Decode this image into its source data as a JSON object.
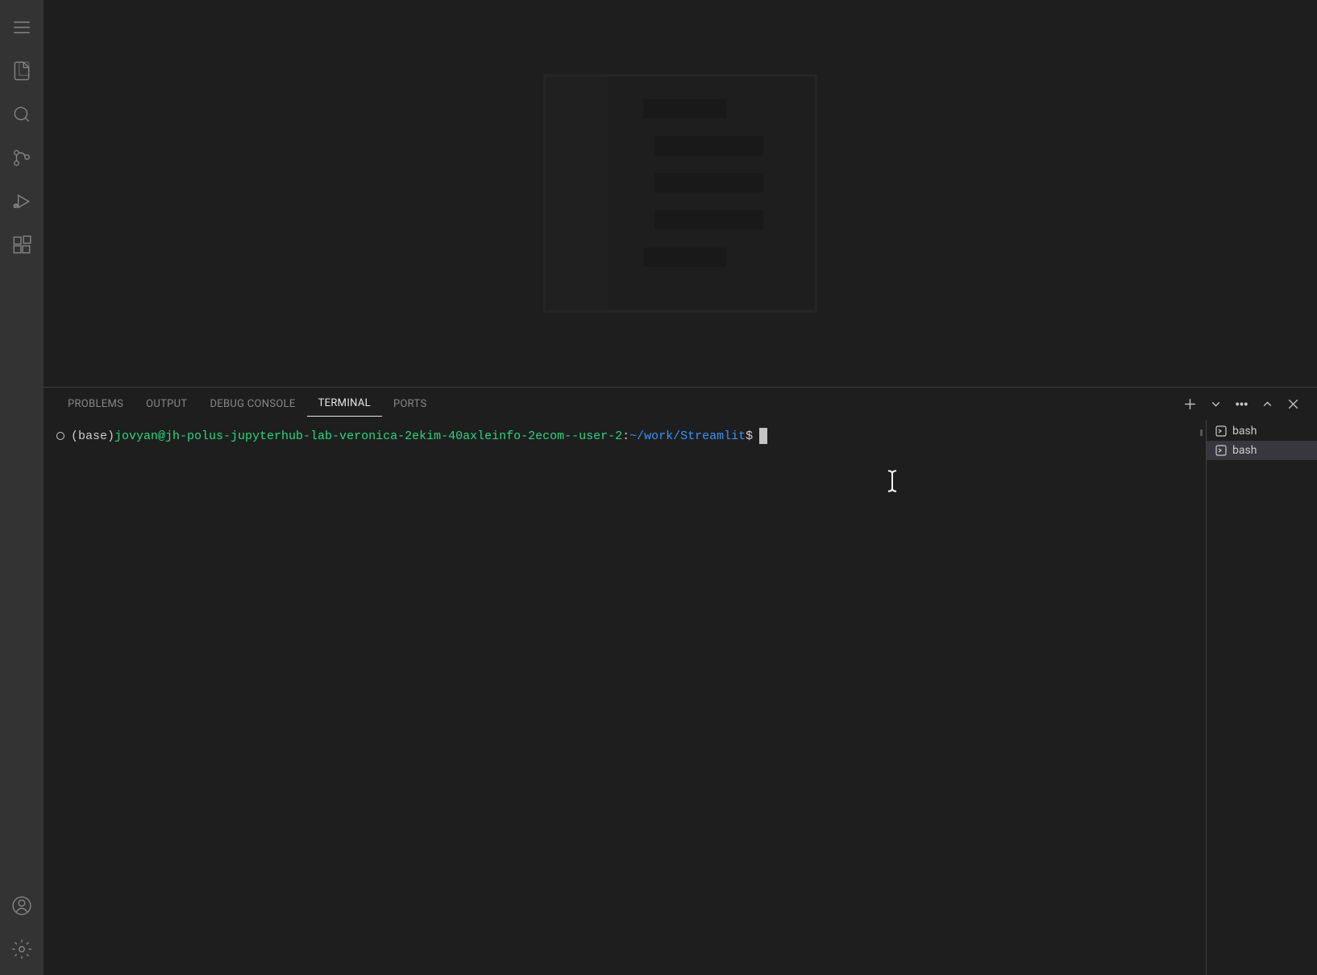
{
  "panel": {
    "tabs": {
      "problems": "PROBLEMS",
      "output": "OUTPUT",
      "debugConsole": "DEBUG CONSOLE",
      "terminal": "TERMINAL",
      "ports": "PORTS"
    }
  },
  "terminal": {
    "base": "(base) ",
    "user": "jovyan@jh-polus-jupyterhub-lab-veronica-2ekim-40axleinfo-2ecom--user-2",
    "colon": ":",
    "path": "~/work/Streamlit",
    "dollar": "$"
  },
  "terminalList": {
    "items": [
      {
        "name": "bash"
      },
      {
        "name": "bash"
      }
    ]
  }
}
